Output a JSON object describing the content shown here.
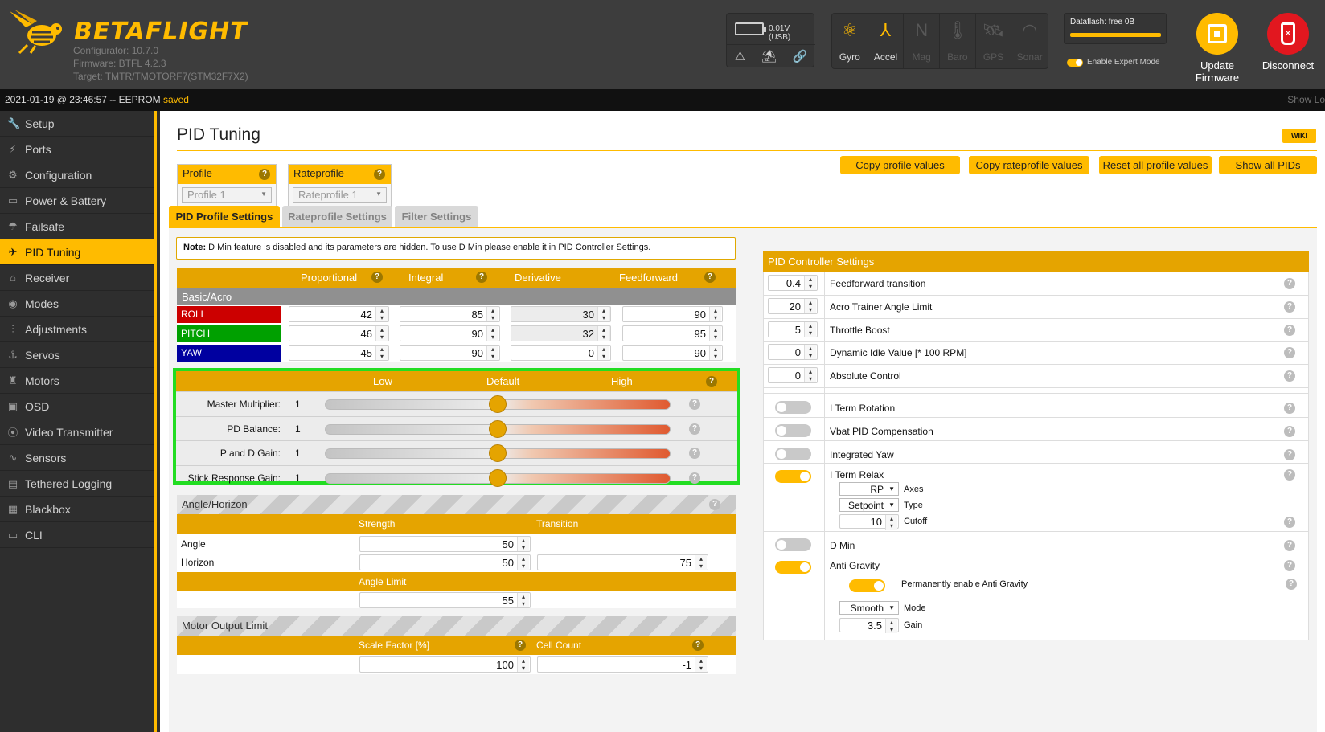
{
  "header": {
    "brand": "BETAFLIGHT",
    "configurator": "Configurator: 10.7.0",
    "firmware": "Firmware: BTFL 4.2.3",
    "target": "Target: TMTR/TMOTORF7(STM32F7X2)",
    "battery": "0.01V (USB)",
    "sensors": [
      {
        "label": "Gyro",
        "active": true,
        "icon": "gyro-icon"
      },
      {
        "label": "Accel",
        "active": true,
        "icon": "accel-icon"
      },
      {
        "label": "Mag",
        "active": false,
        "icon": "mag-icon"
      },
      {
        "label": "Baro",
        "active": false,
        "icon": "baro-icon"
      },
      {
        "label": "GPS",
        "active": false,
        "icon": "gps-icon"
      },
      {
        "label": "Sonar",
        "active": false,
        "icon": "sonar-icon"
      }
    ],
    "dataflash": "Dataflash: free 0B",
    "expert_mode": "Enable Expert Mode",
    "update_firmware": "Update Firmware",
    "disconnect": "Disconnect"
  },
  "status": {
    "left": "2021-01-19 @ 23:46:57 -- EEPROM ",
    "saved": "saved",
    "right": "Show Lo"
  },
  "sidebar": [
    {
      "label": "Setup",
      "icon": "wrench-icon",
      "active": false
    },
    {
      "label": "Ports",
      "icon": "plug-icon",
      "active": false
    },
    {
      "label": "Configuration",
      "icon": "gear-icon",
      "active": false
    },
    {
      "label": "Power & Battery",
      "icon": "battery-icon",
      "active": false
    },
    {
      "label": "Failsafe",
      "icon": "parachute-icon",
      "active": false
    },
    {
      "label": "PID Tuning",
      "icon": "pid-icon",
      "active": true
    },
    {
      "label": "Receiver",
      "icon": "receiver-icon",
      "active": false
    },
    {
      "label": "Modes",
      "icon": "modes-icon",
      "active": false
    },
    {
      "label": "Adjustments",
      "icon": "sliders-icon",
      "active": false
    },
    {
      "label": "Servos",
      "icon": "servo-icon",
      "active": false
    },
    {
      "label": "Motors",
      "icon": "motor-icon",
      "active": false
    },
    {
      "label": "OSD",
      "icon": "osd-icon",
      "active": false
    },
    {
      "label": "Video Transmitter",
      "icon": "vtx-icon",
      "active": false
    },
    {
      "label": "Sensors",
      "icon": "sensors-icon",
      "active": false
    },
    {
      "label": "Tethered Logging",
      "icon": "logging-icon",
      "active": false
    },
    {
      "label": "Blackbox",
      "icon": "blackbox-icon",
      "active": false
    },
    {
      "label": "CLI",
      "icon": "cli-icon",
      "active": false
    }
  ],
  "page": {
    "title": "PID Tuning",
    "wiki": "WIKI",
    "profile_label": "Profile",
    "profile_value": "Profile 1",
    "rateprofile_label": "Rateprofile",
    "rateprofile_value": "Rateprofile 1",
    "buttons": [
      "Copy profile values",
      "Copy rateprofile values",
      "Reset all profile values",
      "Show all PIDs"
    ],
    "tabs": [
      "PID Profile Settings",
      "Rateprofile Settings",
      "Filter Settings"
    ]
  },
  "note": {
    "bold": "Note:",
    "text": " D Min feature is disabled and its parameters are hidden. To use D Min please enable it in PID Controller Settings."
  },
  "pid_table": {
    "headers": [
      "Proportional",
      "Integral",
      "Derivative",
      "Feedforward"
    ],
    "section": "Basic/Acro",
    "rows": [
      {
        "name": "ROLL",
        "color": "#cc0000",
        "values": [
          "42",
          "85",
          "30",
          "90"
        ]
      },
      {
        "name": "PITCH",
        "color": "#00a000",
        "values": [
          "46",
          "90",
          "32",
          "95"
        ]
      },
      {
        "name": "YAW",
        "color": "#0000a0",
        "values": [
          "45",
          "90",
          "0",
          "90"
        ]
      }
    ]
  },
  "sliders": {
    "headers": [
      "Low",
      "Default",
      "High"
    ],
    "rows": [
      {
        "label": "Master Multiplier:",
        "value": "1",
        "level": 0.5
      },
      {
        "label": "PD Balance:",
        "value": "1",
        "level": 0.5
      },
      {
        "label": "P and D Gain:",
        "value": "1",
        "level": 0.5
      },
      {
        "label": "Stick Response Gain:",
        "value": "1",
        "level": 0.5
      }
    ]
  },
  "angle_horizon": {
    "title": "Angle/Horizon",
    "strength": "Strength",
    "transition": "Transition",
    "angle": "Angle",
    "horizon": "Horizon",
    "angle_strength": "50",
    "horizon_strength": "50",
    "horizon_transition": "75",
    "angle_limit_label": "Angle Limit",
    "angle_limit": "55"
  },
  "motor_output": {
    "title": "Motor Output Limit",
    "scale_label": "Scale Factor [%]",
    "cell_label": "Cell Count",
    "scale": "100",
    "cells": "-1"
  },
  "controller": {
    "title": "PID Controller Settings",
    "numeric": [
      {
        "value": "0.4",
        "label": "Feedforward transition"
      },
      {
        "value": "20",
        "label": "Acro Trainer Angle Limit"
      },
      {
        "value": "5",
        "label": "Throttle Boost"
      },
      {
        "value": "0",
        "label": "Dynamic Idle Value [* 100 RPM]"
      },
      {
        "value": "0",
        "label": "Absolute Control"
      }
    ],
    "iterm_rotation": "I Term Rotation",
    "vbat_comp": "Vbat PID Compensation",
    "integrated_yaw": "Integrated Yaw",
    "iterm_relax": "I Term Relax",
    "relax_axes_value": "RP",
    "relax_axes": "Axes",
    "relax_type_value": "Setpoint",
    "relax_type": "Type",
    "relax_cutoff_value": "10",
    "relax_cutoff": "Cutoff",
    "dmin": "D Min",
    "anti_gravity": "Anti Gravity",
    "perm_ag": "Permanently enable Anti Gravity",
    "ag_mode_value": "Smooth",
    "ag_mode": "Mode",
    "ag_gain_value": "3.5",
    "ag_gain": "Gain"
  },
  "colors": {
    "accent": "#ffbb00",
    "highlight": "#22dd22"
  }
}
